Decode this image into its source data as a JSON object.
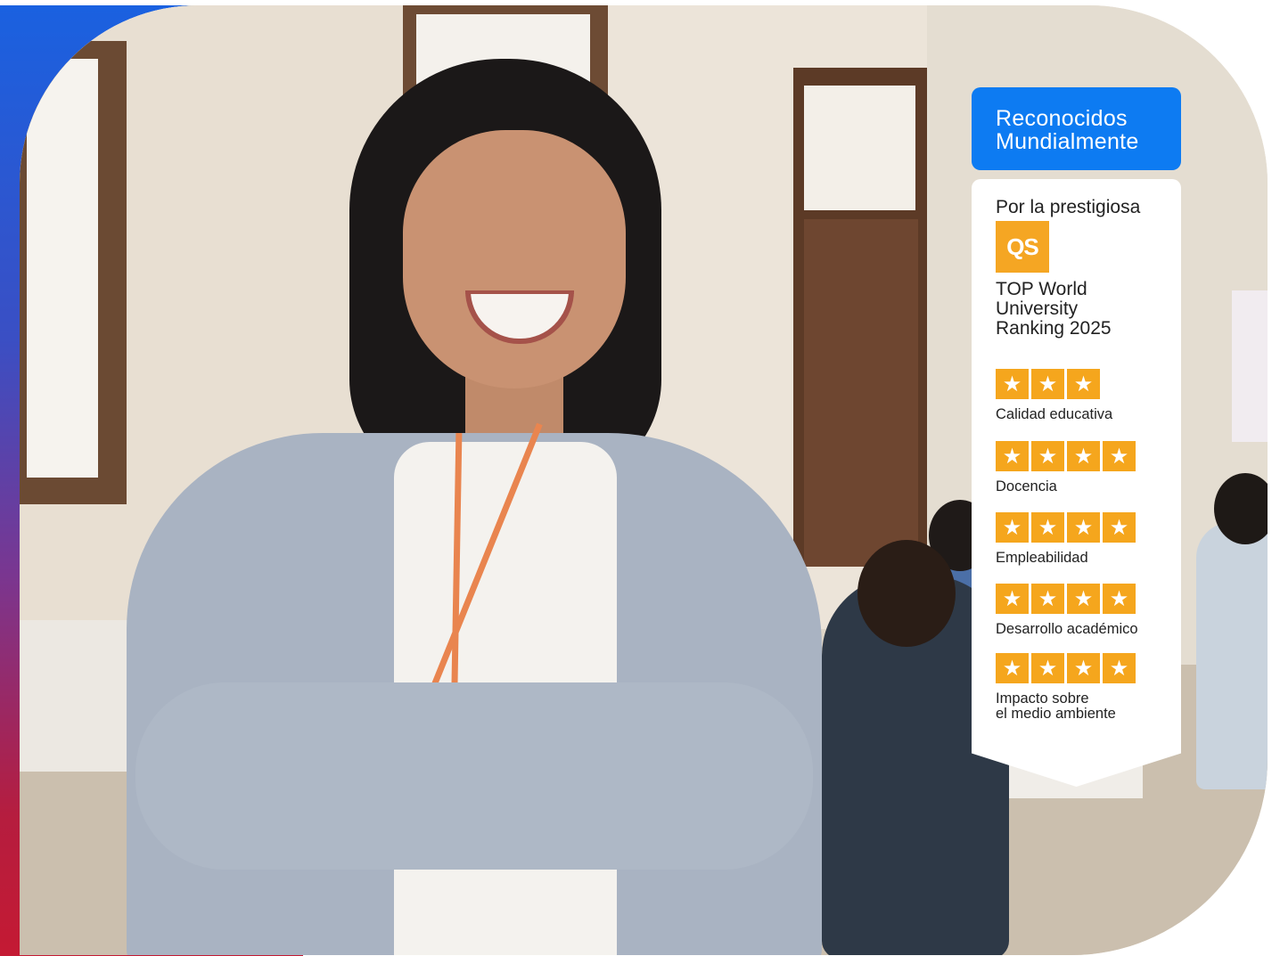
{
  "badge": {
    "header_lines": [
      "Reconocidos",
      "Mundialmente"
    ],
    "intro": "Por la prestigiosa",
    "logo_text": "QS",
    "ranking_lines": [
      "TOP World",
      "University",
      "Ranking 2025"
    ],
    "categories": [
      {
        "label_lines": [
          "Calidad educativa"
        ],
        "stars": 3
      },
      {
        "label_lines": [
          "Docencia"
        ],
        "stars": 4
      },
      {
        "label_lines": [
          "Empleabilidad"
        ],
        "stars": 4
      },
      {
        "label_lines": [
          "Desarrollo académico"
        ],
        "stars": 4
      },
      {
        "label_lines": [
          "Impacto sobre",
          "el medio ambiente"
        ],
        "stars": 4
      }
    ]
  },
  "colors": {
    "header_blue": "#0d7bf2",
    "star_gold": "#f5a61d",
    "logo_gold": "#f5a623",
    "frame_gradient_top": "#1a61e0",
    "frame_gradient_bottom": "#c41a33"
  },
  "icons": {
    "star": "star-icon"
  }
}
